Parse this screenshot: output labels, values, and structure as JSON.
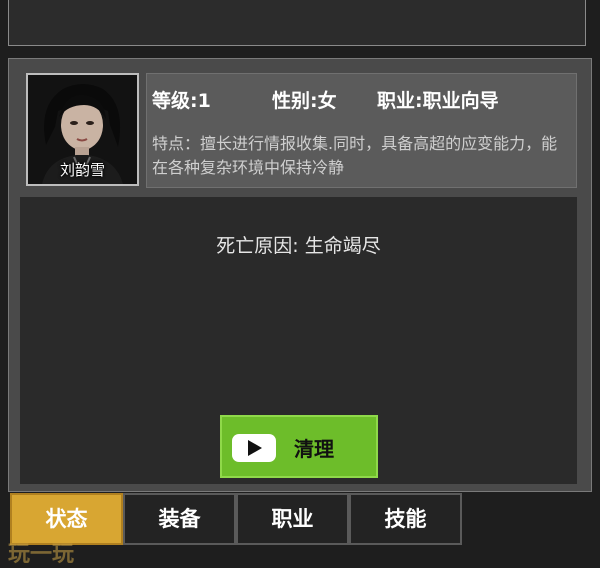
{
  "character": {
    "name": "刘韵雪",
    "level": "等级:1",
    "gender": "性别:女",
    "profession": "职业:职业向导",
    "trait": "特点：擅长进行情报收集.同时，具备高超的应变能力，能在各种复杂环境中保持冷静"
  },
  "status": {
    "death_cause": "死亡原因: 生命竭尽"
  },
  "actions": {
    "clean_label": "清理"
  },
  "tabs": [
    {
      "label": "状态",
      "active": true
    },
    {
      "label": "装备",
      "active": false
    },
    {
      "label": "职业",
      "active": false
    },
    {
      "label": "技能",
      "active": false
    }
  ],
  "watermark": "玩一玩",
  "colors": {
    "button_green": "#6dbd2a",
    "tab_active": "#d8a632"
  }
}
